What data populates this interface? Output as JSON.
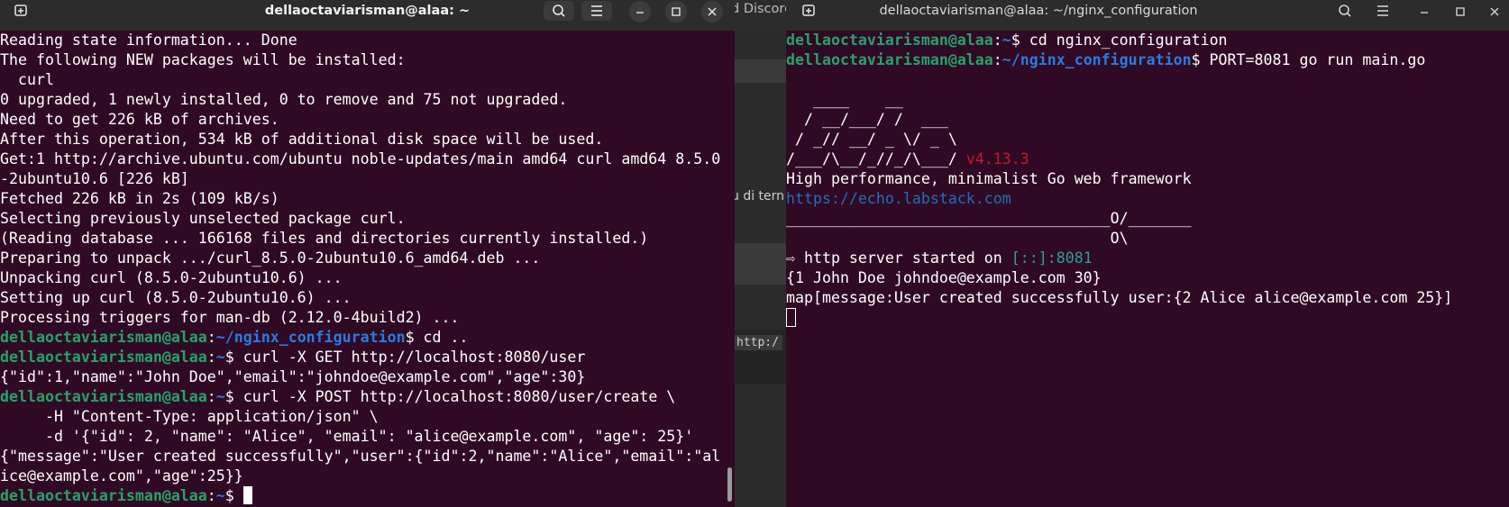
{
  "left_terminal": {
    "title": "dellaoctaviarisman@alaa: ~",
    "lines": [
      [
        {
          "t": "Reading state information... Done"
        }
      ],
      [
        {
          "t": "The following NEW packages will be installed:"
        }
      ],
      [
        {
          "t": "  curl"
        }
      ],
      [
        {
          "t": "0 upgraded, 1 newly installed, 0 to remove and 75 not upgraded."
        }
      ],
      [
        {
          "t": "Need to get 226 kB of archives."
        }
      ],
      [
        {
          "t": "After this operation, 534 kB of additional disk space will be used."
        }
      ],
      [
        {
          "t": "Get:1 http://archive.ubuntu.com/ubuntu noble-updates/main amd64 curl amd64 8.5.0"
        }
      ],
      [
        {
          "t": "-2ubuntu10.6 [226 kB]"
        }
      ],
      [
        {
          "t": "Fetched 226 kB in 2s (109 kB/s)"
        }
      ],
      [
        {
          "t": "Selecting previously unselected package curl."
        }
      ],
      [
        {
          "t": "(Reading database ... 166168 files and directories currently installed.)"
        }
      ],
      [
        {
          "t": "Preparing to unpack .../curl_8.5.0-2ubuntu10.6_amd64.deb ..."
        }
      ],
      [
        {
          "t": "Unpacking curl (8.5.0-2ubuntu10.6) ..."
        }
      ],
      [
        {
          "t": "Setting up curl (8.5.0-2ubuntu10.6) ..."
        }
      ],
      [
        {
          "t": "Processing triggers for man-db (2.12.0-4build2) ..."
        }
      ],
      [
        {
          "t": "dellaoctaviarisman@alaa",
          "c": "u"
        },
        {
          "t": ":"
        },
        {
          "t": "~/nginx_configuration",
          "c": "p"
        },
        {
          "t": "$ cd .."
        }
      ],
      [
        {
          "t": "dellaoctaviarisman@alaa",
          "c": "u"
        },
        {
          "t": ":"
        },
        {
          "t": "~",
          "c": "p"
        },
        {
          "t": "$ curl -X GET http://localhost:8080/user"
        }
      ],
      [
        {
          "t": "{\"id\":1,\"name\":\"John Doe\",\"email\":\"johndoe@example.com\",\"age\":30}"
        }
      ],
      [
        {
          "t": "dellaoctaviarisman@alaa",
          "c": "u"
        },
        {
          "t": ":"
        },
        {
          "t": "~",
          "c": "p"
        },
        {
          "t": "$ curl -X POST http://localhost:8080/user/create \\"
        }
      ],
      [
        {
          "t": "     -H \"Content-Type: application/json\" \\"
        }
      ],
      [
        {
          "t": "     -d '{\"id\": 2, \"name\": \"Alice\", \"email\": \"alice@example.com\", \"age\": 25}'"
        }
      ],
      [
        {
          "t": "{\"message\":\"User created successfully\",\"user\":{\"id\":2,\"name\":\"Alice\",\"email\":\"al"
        }
      ],
      [
        {
          "t": "ice@example.com\",\"age\":25}}"
        }
      ],
      [
        {
          "t": "dellaoctaviarisman@alaa",
          "c": "u"
        },
        {
          "t": ":"
        },
        {
          "t": "~",
          "c": "p"
        },
        {
          "t": "$ "
        },
        {
          "cursor": "solid"
        }
      ]
    ]
  },
  "right_terminal": {
    "title": "dellaoctaviarisman@alaa: ~/nginx_configuration",
    "lines": [
      [
        {
          "t": "dellaoctaviarisman@alaa",
          "c": "u"
        },
        {
          "t": ":"
        },
        {
          "t": "~",
          "c": "p"
        },
        {
          "t": "$ cd nginx_configuration"
        }
      ],
      [
        {
          "t": "dellaoctaviarisman@alaa",
          "c": "u"
        },
        {
          "t": ":"
        },
        {
          "t": "~/nginx_configuration",
          "c": "p"
        },
        {
          "t": "$ PORT=8081 go run main.go"
        }
      ],
      [
        {
          "t": ""
        }
      ],
      [
        {
          "t": "   ____    __"
        }
      ],
      [
        {
          "t": "  / __/___/ /  ___"
        }
      ],
      [
        {
          "t": " / _// __/ _ \\/ _ \\"
        }
      ],
      [
        {
          "t": "/___/\\__/_//_/\\___/ "
        },
        {
          "t": "v4.13.3",
          "c": "red"
        }
      ],
      [
        {
          "t": "High performance, minimalist Go web framework"
        }
      ],
      [
        {
          "t": "https://echo.labstack.com",
          "c": "url"
        }
      ],
      [
        {
          "t": "____________________________________O/_______"
        }
      ],
      [
        {
          "t": "                                    O\\"
        }
      ],
      [
        {
          "t": "⇨ http server started on "
        },
        {
          "t": "[::]:8081",
          "c": "cyan"
        }
      ],
      [
        {
          "t": "{1 John Doe johndoe@example.com 30}"
        }
      ],
      [
        {
          "t": "map[message:User created successfully user:{2 Alice alice@example.com 25}]"
        }
      ],
      [
        {
          "cursor": "hollow"
        }
      ]
    ]
  },
  "background_window": {
    "tab_fragment": "d Discord",
    "text_fragment": "u di tern",
    "url_fragment": "http:/"
  },
  "colors": {
    "terminal_bg": "#300a24",
    "titlebar_bg": "#2c2c2c",
    "prompt_user": "#26a269",
    "prompt_path": "#2a7bde"
  }
}
